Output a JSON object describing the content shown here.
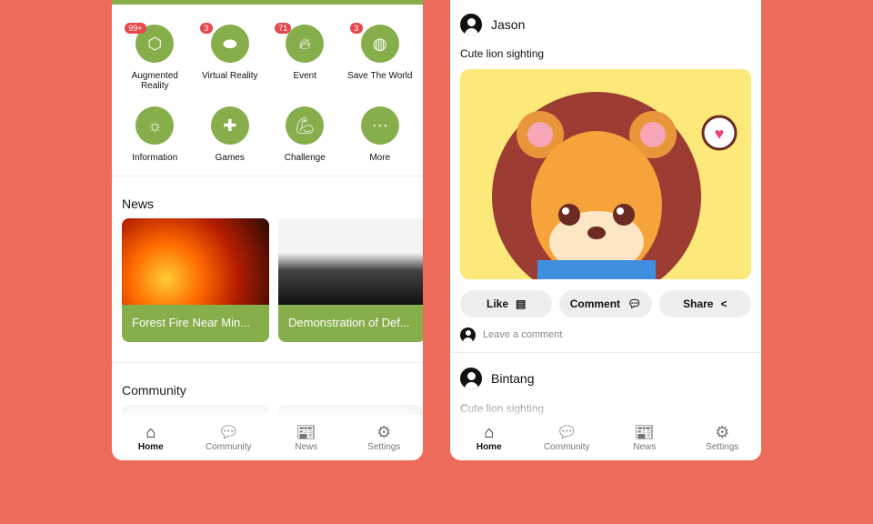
{
  "colors": {
    "background": "#EC6B5A",
    "accent": "#86AE4B",
    "badge": "#E5484D"
  },
  "home": {
    "categories": [
      {
        "label": "Augmented Reality",
        "icon": "ar-cube-icon",
        "badge": "99+"
      },
      {
        "label": "Virtual Reality",
        "icon": "vr-headset-icon",
        "badge": "3"
      },
      {
        "label": "Event",
        "icon": "campfire-icon",
        "badge": "71"
      },
      {
        "label": "Save The World",
        "icon": "globe-icon",
        "badge": "3"
      },
      {
        "label": "Information",
        "icon": "lightbulb-icon"
      },
      {
        "label": "Games",
        "icon": "gamepad-icon"
      },
      {
        "label": "Challenge",
        "icon": "muscle-icon"
      },
      {
        "label": "More",
        "icon": "more-icon"
      }
    ],
    "news_title": "News",
    "news": [
      {
        "title": "Forest Fire Near Min..."
      },
      {
        "title": "Demonstration of Def..."
      }
    ],
    "community_title": "Community"
  },
  "feed": {
    "posts": [
      {
        "user": "Jason",
        "caption": "Cute lion sighting"
      },
      {
        "user": "Bintang",
        "caption": "Cute lion sighting"
      }
    ],
    "actions": {
      "like": "Like",
      "comment": "Comment",
      "share": "Share"
    },
    "comment_placeholder": "Leave a comment"
  },
  "nav": [
    {
      "label": "Home",
      "icon": "home-icon",
      "active": true
    },
    {
      "label": "Community",
      "icon": "chat-icon"
    },
    {
      "label": "News",
      "icon": "newspaper-icon"
    },
    {
      "label": "Settings",
      "icon": "gear-icon"
    }
  ]
}
